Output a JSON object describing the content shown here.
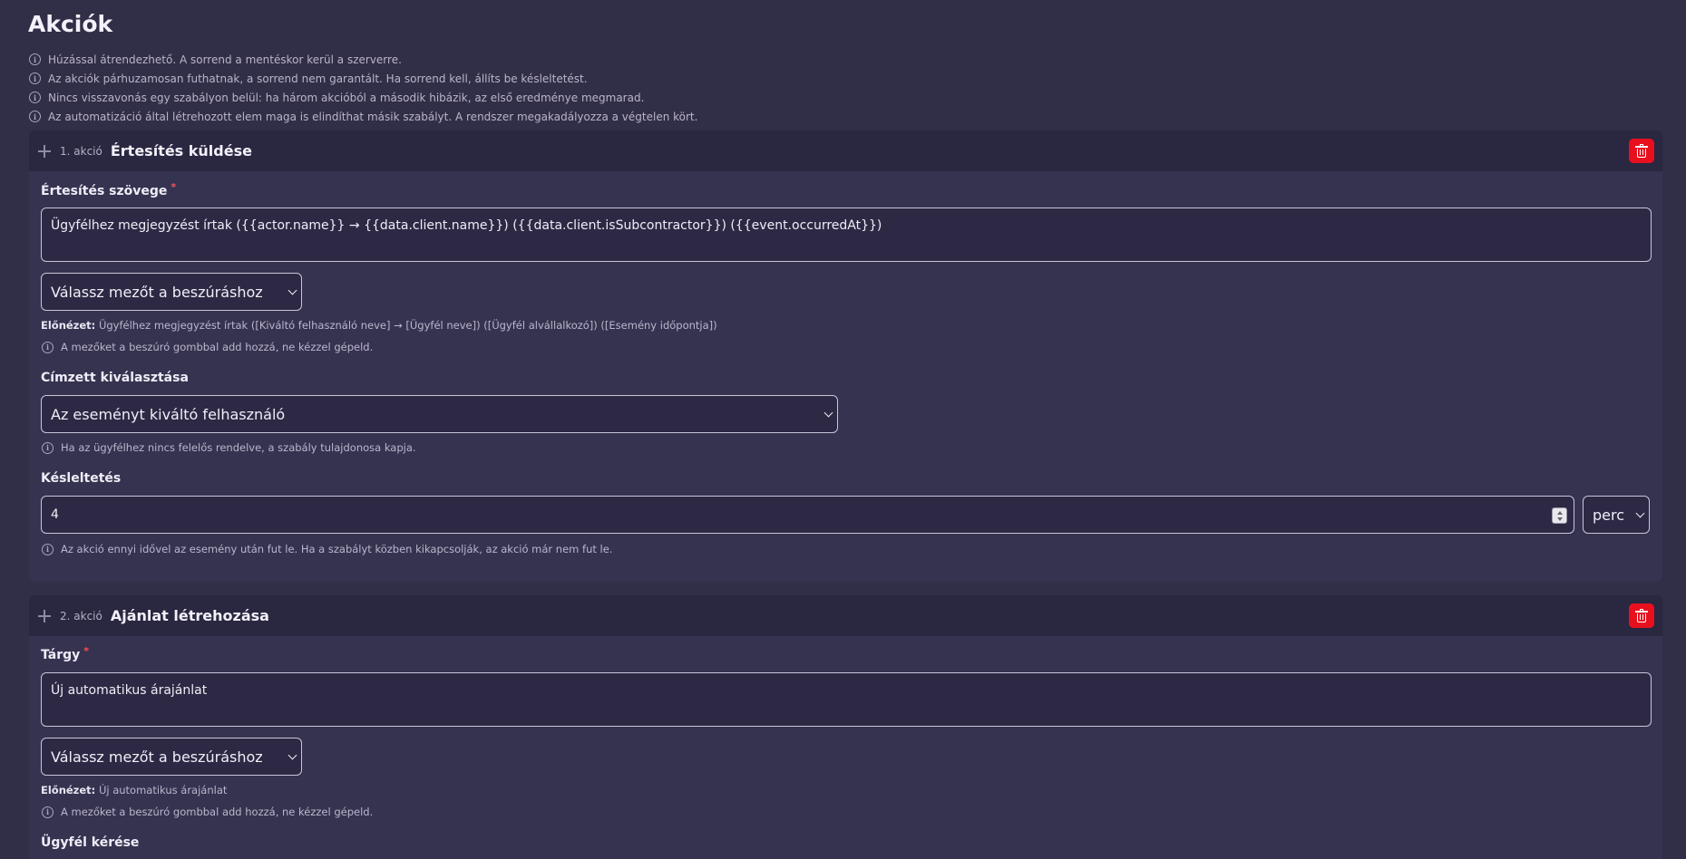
{
  "page": {
    "title": "Akciók",
    "notes": [
      "Húzással átrendezhető. A sorrend a mentéskor kerül a szerverre.",
      "Az akciók párhuzamosan futhatnak, a sorrend nem garantált. Ha sorrend kell, állíts be késleltetést.",
      "Nincs visszavonás egy szabályon belül: ha három akcióból a második hibázik, az első eredménye megmarad.",
      "Az automatizáció által létrehozott elem maga is elindíthat másik szabályt. A rendszer megakadályozza a végtelen kört."
    ]
  },
  "actions": [
    {
      "number": "1. akció",
      "name": "Értesítés küldése",
      "text_label": "Értesítés szövege",
      "required_mark": "*",
      "text_value": "Ügyfélhez megjegyzést írtak ({{actor.name}} → {{data.client.name}}) ({{data.client.isSubcontractor}}) ({{event.occurredAt}})",
      "insert_select": "Válassz mezőt a beszúráshoz",
      "preview_label": "Előnézet:",
      "preview_value": "Ügyfélhez megjegyzést írtak ([Kiváltó felhasználó neve] → [Ügyfél neve]) ([Ügyfél alvállalkozó]) ([Esemény időpontja])",
      "insert_hint": "A mezőket a beszúró gombbal add hozzá, ne kézzel gépeld.",
      "recipient_label": "Címzett kiválasztása",
      "recipient_value": "Az eseményt kiváltó felhasználó",
      "recipient_hint": "Ha az ügyfélhez nincs felelős rendelve, a szabály tulajdonosa kapja.",
      "delay_label": "Késleltetés",
      "delay_value": "4",
      "delay_unit": "perc",
      "delay_hint": "Az akció ennyi idővel az esemény után fut le. Ha a szabályt közben kikapcsolják, az akció már nem fut le."
    },
    {
      "number": "2. akció",
      "name": "Ajánlat létrehozása",
      "text_label": "Tárgy",
      "required_mark": "*",
      "text_value": "Új automatikus árajánlat",
      "insert_select": "Válassz mezőt a beszúráshoz",
      "preview_label": "Előnézet:",
      "preview_value": "Új automatikus árajánlat",
      "insert_hint": "A mezőket a beszúró gombbal add hozzá, ne kézzel gépeld.",
      "client_label": "Ügyfél kérése"
    }
  ],
  "icons": {
    "info": "info-icon",
    "drag": "drag-handle-icon",
    "delete": "trash-icon",
    "chevron": "chevron-down-icon"
  },
  "colors": {
    "background": "#312e47",
    "card": "#363350",
    "card_header": "#2a2740",
    "delete": "#e8101e",
    "required": "#ff4d57"
  }
}
